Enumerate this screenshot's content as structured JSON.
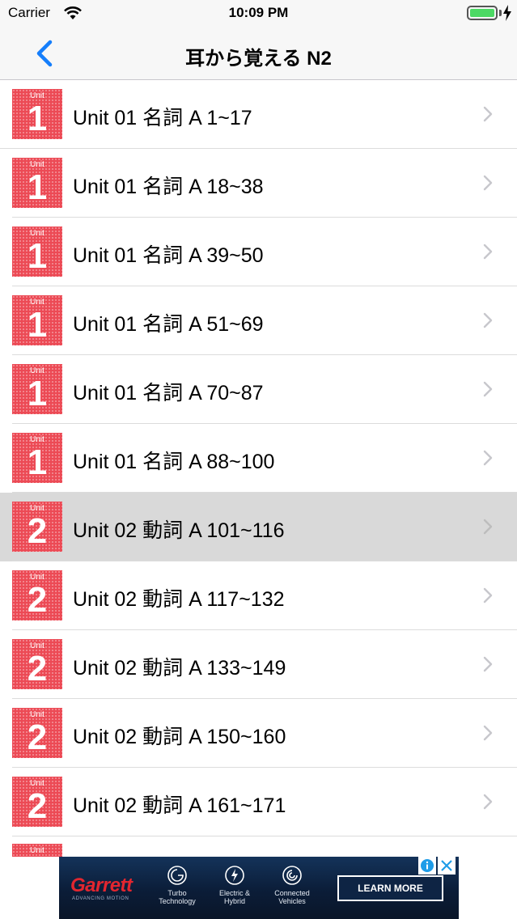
{
  "status_bar": {
    "carrier": "Carrier",
    "time": "10:09 PM",
    "battery_color": "#4cd964"
  },
  "nav": {
    "back_icon": "chevron-left-icon",
    "title": "耳から覚える N2",
    "accent_color": "#157efb"
  },
  "list": {
    "badge_small_label": "Unit",
    "badge_color": "#ec4a55",
    "selected_color": "#d9d9d9",
    "items": [
      {
        "unit": "1",
        "label": "Unit 01 名詞 A 1~17"
      },
      {
        "unit": "1",
        "label": "Unit 01 名詞 A 18~38"
      },
      {
        "unit": "1",
        "label": "Unit 01 名詞 A 39~50"
      },
      {
        "unit": "1",
        "label": "Unit 01 名詞 A 51~69"
      },
      {
        "unit": "1",
        "label": "Unit 01 名詞 A 70~87"
      },
      {
        "unit": "1",
        "label": "Unit 01 名詞 A 88~100"
      },
      {
        "unit": "2",
        "label": "Unit 02 動詞 A 101~116",
        "selected": true
      },
      {
        "unit": "2",
        "label": "Unit 02 動詞 A 117~132"
      },
      {
        "unit": "2",
        "label": "Unit 02 動詞 A 133~149"
      },
      {
        "unit": "2",
        "label": "Unit 02 動詞 A 150~160"
      },
      {
        "unit": "2",
        "label": "Unit 02 動詞 A 161~171"
      }
    ],
    "partial_item": {
      "badge_small_label": "Unit"
    }
  },
  "ad": {
    "brand": "Garrett",
    "tagline": "ADVANCING MOTION",
    "brand_color": "#e3262f",
    "features": [
      {
        "line1": "Turbo",
        "line2": "Technology",
        "icon": "turbo-icon"
      },
      {
        "line1": "Electric &",
        "line2": "Hybrid",
        "icon": "electric-icon"
      },
      {
        "line1": "Connected",
        "line2": "Vehicles",
        "icon": "connected-icon"
      }
    ],
    "cta": "LEARN MORE",
    "info_icon": "info-icon",
    "close_icon": "close-icon"
  }
}
